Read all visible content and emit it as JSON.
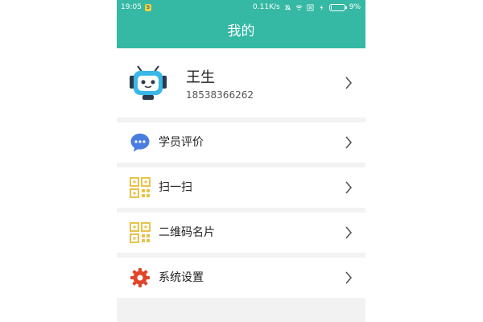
{
  "status_bar": {
    "time": "19:05",
    "speed": "0.11K/s",
    "battery": "9%",
    "battery_level": 0.09,
    "icons": [
      "notification-badge-icon",
      "bell-off-icon",
      "wifi-icon",
      "close-box-icon",
      "charging-icon",
      "battery-icon"
    ]
  },
  "header": {
    "title": "我的"
  },
  "profile": {
    "name": "王生",
    "phone": "18538366262",
    "avatar_icon": "robot-avatar-icon"
  },
  "menu": [
    {
      "label": "学员评价",
      "icon": "chat-bubble-icon",
      "color": "#4a7de0"
    },
    {
      "label": "扫一扫",
      "icon": "qr-code-icon",
      "color": "#e8c24a"
    },
    {
      "label": "二维码名片",
      "icon": "qr-code-icon",
      "color": "#e8c24a"
    },
    {
      "label": "系统设置",
      "icon": "gear-icon",
      "color": "#e0452a"
    }
  ],
  "colors": {
    "accent": "#35b8a4",
    "background": "#f2f2f2"
  }
}
